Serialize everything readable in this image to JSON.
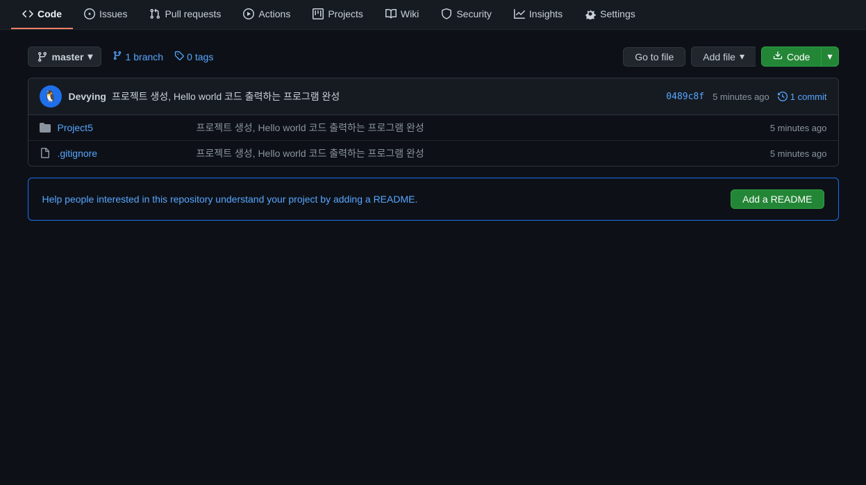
{
  "nav": {
    "items": [
      {
        "id": "code",
        "label": "Code",
        "active": true
      },
      {
        "id": "issues",
        "label": "Issues"
      },
      {
        "id": "pull-requests",
        "label": "Pull requests"
      },
      {
        "id": "actions",
        "label": "Actions"
      },
      {
        "id": "projects",
        "label": "Projects"
      },
      {
        "id": "wiki",
        "label": "Wiki"
      },
      {
        "id": "security",
        "label": "Security"
      },
      {
        "id": "insights",
        "label": "Insights"
      },
      {
        "id": "settings",
        "label": "Settings"
      }
    ]
  },
  "toolbar": {
    "branch": "master",
    "branches_count": "1",
    "branches_label": "branch",
    "tags_count": "0",
    "tags_label": "tags",
    "go_to_file_label": "Go to file",
    "add_file_label": "Add file",
    "code_label": "Code"
  },
  "commit_header": {
    "author": "Devying",
    "message": "프로젝트 생성, Hello world 코드 출력하는 프로그램 완성",
    "hash": "0489c8f",
    "time": "5 minutes ago",
    "commit_count": "1 commit",
    "avatar_emoji": "🐧"
  },
  "files": [
    {
      "type": "folder",
      "name": "Project5",
      "commit_msg": "프로젝트 생성, Hello world 코드 출력하는 프로그램 완성",
      "time": "5 minutes ago"
    },
    {
      "type": "file",
      "name": ".gitignore",
      "commit_msg": "프로젝트 생성, Hello world 코드 출력하는 프로그램 완성",
      "time": "5 minutes ago"
    }
  ],
  "readme_banner": {
    "text": "Help people interested in this repository understand your project by adding a README.",
    "button_label": "Add a README"
  }
}
